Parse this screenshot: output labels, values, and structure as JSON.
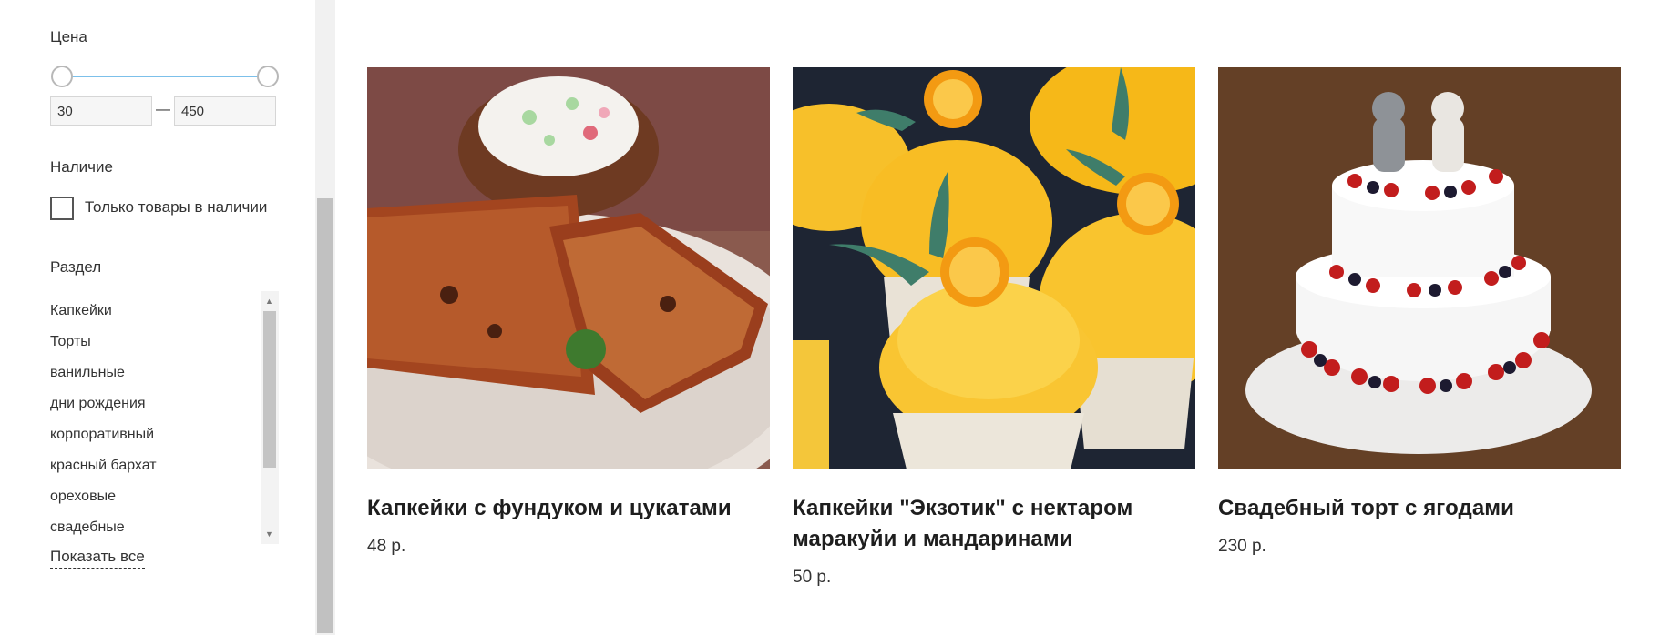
{
  "filters": {
    "price": {
      "title": "Цена",
      "min_value": "30",
      "max_value": "450",
      "separator": "—"
    },
    "availability": {
      "title": "Наличие",
      "checkbox_label": "Только товары в наличии",
      "checked": false
    },
    "section": {
      "title": "Раздел",
      "items": [
        {
          "label": "Капкейки"
        },
        {
          "label": "Торты"
        },
        {
          "label": "ванильные"
        },
        {
          "label": "дни рождения"
        },
        {
          "label": "корпоративный"
        },
        {
          "label": "красный бархат"
        },
        {
          "label": "ореховые"
        },
        {
          "label": "свадебные"
        }
      ],
      "show_all": "Показать все"
    }
  },
  "products": [
    {
      "name": "Капкейки с фундуком и цукатами",
      "price": "48 р.",
      "image": "cupcake-with-hazelnuts-photo"
    },
    {
      "name": "Капкейки \"Экзотик\" с нектаром маракуйи и мандаринами",
      "price": "50 р.",
      "image": "exotic-cupcakes-photo"
    },
    {
      "name": "Свадебный торт с ягодами",
      "price": "230 р.",
      "image": "wedding-cake-berries-photo"
    }
  ],
  "colors": {
    "range_track": "#7cc0ea",
    "text": "#1e1e1e"
  }
}
